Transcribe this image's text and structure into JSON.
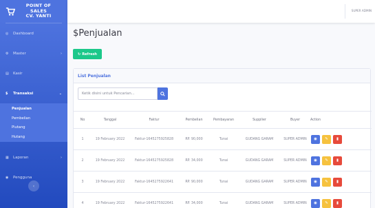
{
  "sidebar": {
    "brand_line1": "POINT OF",
    "brand_line2": "SALES",
    "brand_line3": "CV. YANTI",
    "items": [
      {
        "label": "Dashboard",
        "icon": "dashboard-icon"
      },
      {
        "label": "Master",
        "icon": "cog-icon"
      },
      {
        "label": "Kasir",
        "icon": "cart-icon"
      },
      {
        "label": "Transaksi",
        "icon": "dollar-icon"
      },
      {
        "label": "Laporan",
        "icon": "report-icon"
      },
      {
        "label": "Pengguna",
        "icon": "user-icon"
      }
    ],
    "submenu": [
      "Penjualan",
      "Pembelian",
      "Piutang",
      "Hutang"
    ]
  },
  "topbar": {
    "user": "SUPER ADMIN"
  },
  "page": {
    "title": "Penjualan",
    "refresh_label": "Refresh"
  },
  "card": {
    "title": "List Penjualan",
    "search_placeholder": "Ketik disini untuk Pencarian...",
    "columns": [
      "No",
      "Tanggal",
      "Faktur",
      "Pembelian",
      "Pembayaran",
      "Supplier",
      "Buyer",
      "Action"
    ],
    "rows": [
      [
        "1",
        "19 February 2022",
        "Faktur-1645275925828",
        "RP. 90,000",
        "Tunai",
        "GUDANG GARAM",
        "SUPER ADMIN"
      ],
      [
        "2",
        "19 February 2022",
        "Faktur-1645275925828",
        "RP. 34,000",
        "Tunai",
        "GUDANG GARAM",
        "SUPER ADMIN"
      ],
      [
        "3",
        "19 February 2022",
        "Faktur-1645275922641",
        "RP. 90,000",
        "Tunai",
        "GUDANG GARAM",
        "SUPER ADMIN"
      ],
      [
        "4",
        "19 February 2022",
        "Faktur-1645275922641",
        "RP. 34,000",
        "Tunai",
        "GUDANG GARAM",
        "SUPER ADMIN"
      ]
    ]
  },
  "colors": {
    "primary": "#4e73df",
    "success": "#1cc88a",
    "warning": "#f6c23e",
    "danger": "#e74a3b"
  }
}
